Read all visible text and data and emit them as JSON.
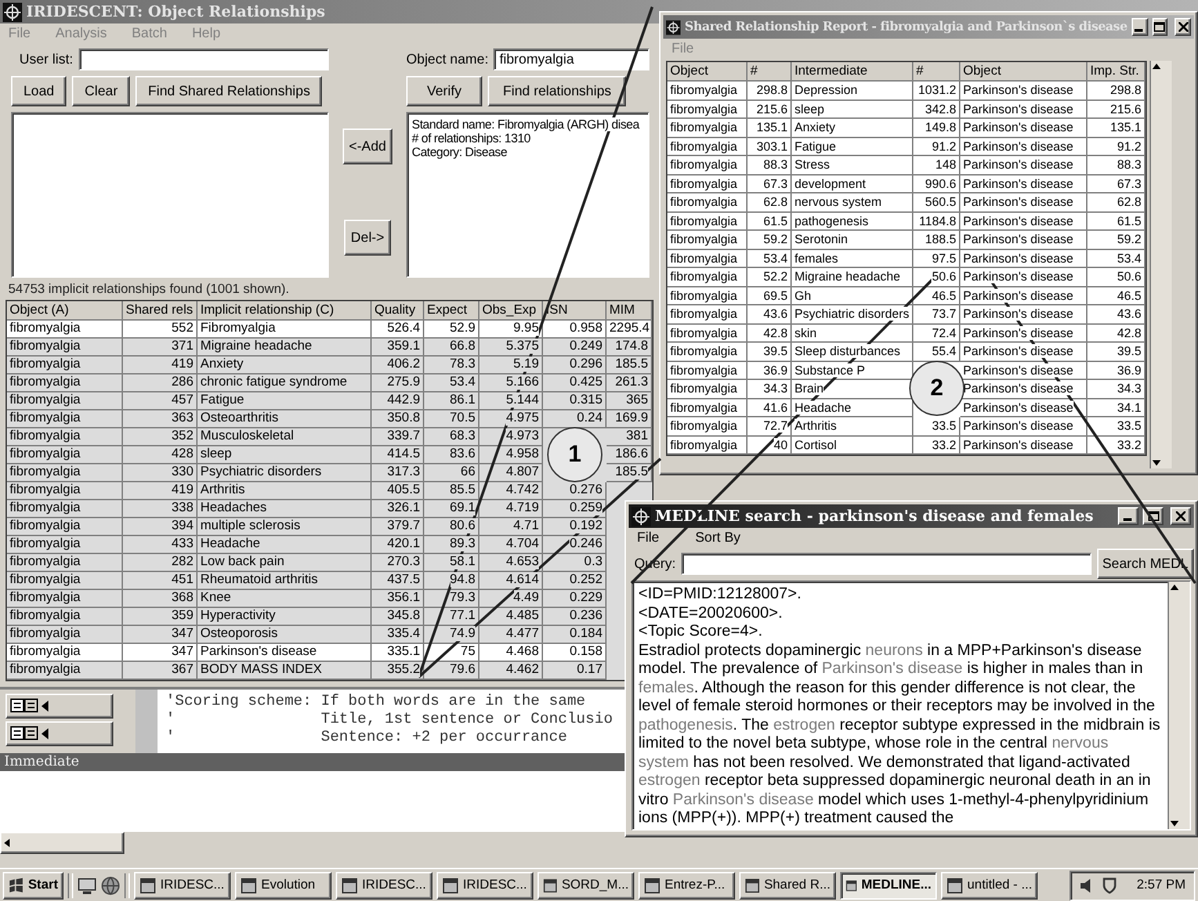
{
  "main_window": {
    "title": "IRIDESCENT: Object Relationships",
    "menu": [
      "File",
      "Analysis",
      "Batch",
      "Help"
    ],
    "user_list": {
      "label": "User list:"
    },
    "left_buttons": [
      "Load",
      "Clear",
      "Find Shared Relationships"
    ],
    "middle_buttons": [
      "<-Add",
      "Del->"
    ],
    "object_name": {
      "label": "Object name:",
      "value": "fibromyalgia"
    },
    "right_buttons": [
      "Verify",
      "Find relationships"
    ],
    "info_lines": [
      "Standard name: Fibromyalgia (ARGH) disea",
      "# of relationships: 1310",
      "Category: Disease"
    ],
    "status": "54753 implicit relationships found (1001 shown).",
    "table": {
      "columns": [
        "Object (A)",
        "Shared rels",
        "Implicit relationship (C)",
        "Quality",
        "Expect",
        "Obs_Exp",
        "ISN",
        "MIM"
      ],
      "rows": [
        {
          "object": "fibromyalgia",
          "shared": "552",
          "relationship": "Fibromyalgia",
          "quality": "526.4",
          "expect": "52.9",
          "obs_exp": "9.95",
          "isn": "0.958",
          "mim": "2295.4",
          "selected": true
        },
        {
          "object": "fibromyalgia",
          "shared": "371",
          "relationship": "Migraine headache",
          "quality": "359.1",
          "expect": "66.8",
          "obs_exp": "5.375",
          "isn": "0.249",
          "mim": "174.8",
          "selected": false
        },
        {
          "object": "fibromyalgia",
          "shared": "419",
          "relationship": "Anxiety",
          "quality": "406.2",
          "expect": "78.3",
          "obs_exp": "5.19",
          "isn": "0.296",
          "mim": "185.5",
          "selected": false
        },
        {
          "object": "fibromyalgia",
          "shared": "286",
          "relationship": "chronic fatigue syndrome",
          "quality": "275.9",
          "expect": "53.4",
          "obs_exp": "5.166",
          "isn": "0.425",
          "mim": "261.3",
          "selected": false
        },
        {
          "object": "fibromyalgia",
          "shared": "457",
          "relationship": "Fatigue",
          "quality": "442.9",
          "expect": "86.1",
          "obs_exp": "5.144",
          "isn": "0.315",
          "mim": "365",
          "selected": false
        },
        {
          "object": "fibromyalgia",
          "shared": "363",
          "relationship": "Osteoarthritis",
          "quality": "350.8",
          "expect": "70.5",
          "obs_exp": "4.975",
          "isn": "0.24",
          "mim": "169.9",
          "selected": false
        },
        {
          "object": "fibromyalgia",
          "shared": "352",
          "relationship": "Musculoskeletal",
          "quality": "339.7",
          "expect": "68.3",
          "obs_exp": "4.973",
          "mim": "381",
          "selected": false
        },
        {
          "object": "fibromyalgia",
          "shared": "428",
          "relationship": "sleep",
          "quality": "414.5",
          "expect": "83.6",
          "obs_exp": "4.958",
          "mim": "186.6",
          "selected": false
        },
        {
          "object": "fibromyalgia",
          "shared": "330",
          "relationship": "Psychiatric disorders",
          "quality": "317.3",
          "expect": "66",
          "obs_exp": "4.807",
          "mim": "185.5",
          "selected": false
        },
        {
          "object": "fibromyalgia",
          "shared": "419",
          "relationship": "Arthritis",
          "quality": "405.5",
          "expect": "85.5",
          "obs_exp": "4.742",
          "isn": "0.276",
          "selected": false
        },
        {
          "object": "fibromyalgia",
          "shared": "338",
          "relationship": "Headaches",
          "quality": "326.1",
          "expect": "69.1",
          "obs_exp": "4.719",
          "isn": "0.259",
          "selected": false
        },
        {
          "object": "fibromyalgia",
          "shared": "394",
          "relationship": "multiple sclerosis",
          "quality": "379.7",
          "expect": "80.6",
          "obs_exp": "4.71",
          "isn": "0.192",
          "selected": false
        },
        {
          "object": "fibromyalgia",
          "shared": "433",
          "relationship": "Headache",
          "quality": "420.1",
          "expect": "89.3",
          "obs_exp": "4.704",
          "isn": "0.246",
          "selected": false
        },
        {
          "object": "fibromyalgia",
          "shared": "282",
          "relationship": "Low back pain",
          "quality": "270.3",
          "expect": "58.1",
          "obs_exp": "4.653",
          "isn": "0.3",
          "selected": false
        },
        {
          "object": "fibromyalgia",
          "shared": "451",
          "relationship": "Rheumatoid arthritis",
          "quality": "437.5",
          "expect": "94.8",
          "obs_exp": "4.614",
          "isn": "0.252",
          "selected": false
        },
        {
          "object": "fibromyalgia",
          "shared": "368",
          "relationship": "Knee",
          "quality": "356.1",
          "expect": "79.3",
          "obs_exp": "4.49",
          "isn": "0.229",
          "selected": false
        },
        {
          "object": "fibromyalgia",
          "shared": "359",
          "relationship": "Hyperactivity",
          "quality": "345.8",
          "expect": "77.1",
          "obs_exp": "4.485",
          "isn": "0.236",
          "selected": false
        },
        {
          "object": "fibromyalgia",
          "shared": "347",
          "relationship": "Osteoporosis",
          "quality": "335.4",
          "expect": "74.9",
          "obs_exp": "4.477",
          "isn": "0.184",
          "selected": false
        },
        {
          "object": "fibromyalgia",
          "shared": "347",
          "relationship": "Parkinson's disease",
          "quality": "335.1",
          "expect": "75",
          "obs_exp": "4.468",
          "isn": "0.158",
          "selected": true
        },
        {
          "object": "fibromyalgia",
          "shared": "367",
          "relationship": "BODY MASS INDEX",
          "quality": "355.2",
          "expect": "79.6",
          "obs_exp": "4.462",
          "isn": "0.17",
          "selected": false
        }
      ]
    },
    "code_lines": [
      "'Scoring scheme: If both words are in the same",
      "'                Title, 1st sentence or Conclusio",
      "'                Sentence: +2 per occurrance"
    ],
    "immediate": {
      "title": "Immediate"
    }
  },
  "report_window": {
    "title": "Shared Relationship Report - fibromyalgia and Parkinson`s disease",
    "menu": [
      "File"
    ],
    "columns": [
      "Object",
      "#",
      "Intermediate",
      "#",
      "Object",
      "Imp. Str."
    ],
    "rows": [
      {
        "a": "fibromyalgia",
        "n1": "298.8",
        "mid": "Depression",
        "n2": "1031.2",
        "b": "Parkinson's disease",
        "imp": "298.8"
      },
      {
        "a": "fibromyalgia",
        "n1": "215.6",
        "mid": "sleep",
        "n2": "342.8",
        "b": "Parkinson's disease",
        "imp": "215.6"
      },
      {
        "a": "fibromyalgia",
        "n1": "135.1",
        "mid": "Anxiety",
        "n2": "149.8",
        "b": "Parkinson's disease",
        "imp": "135.1"
      },
      {
        "a": "fibromyalgia",
        "n1": "303.1",
        "mid": "Fatigue",
        "n2": "91.2",
        "b": "Parkinson's disease",
        "imp": "91.2"
      },
      {
        "a": "fibromyalgia",
        "n1": "88.3",
        "mid": "Stress",
        "n2": "148",
        "b": "Parkinson's disease",
        "imp": "88.3"
      },
      {
        "a": "fibromyalgia",
        "n1": "67.3",
        "mid": "development",
        "n2": "990.6",
        "b": "Parkinson's disease",
        "imp": "67.3"
      },
      {
        "a": "fibromyalgia",
        "n1": "62.8",
        "mid": "nervous system",
        "n2": "560.5",
        "b": "Parkinson's disease",
        "imp": "62.8"
      },
      {
        "a": "fibromyalgia",
        "n1": "61.5",
        "mid": "pathogenesis",
        "n2": "1184.8",
        "b": "Parkinson's disease",
        "imp": "61.5"
      },
      {
        "a": "fibromyalgia",
        "n1": "59.2",
        "mid": "Serotonin",
        "n2": "188.5",
        "b": "Parkinson's disease",
        "imp": "59.2"
      },
      {
        "a": "fibromyalgia",
        "n1": "53.4",
        "mid": "females",
        "n2": "97.5",
        "b": "Parkinson's disease",
        "imp": "53.4"
      },
      {
        "a": "fibromyalgia",
        "n1": "52.2",
        "mid": "Migraine headache",
        "n2": "50.6",
        "b": "Parkinson's disease",
        "imp": "50.6"
      },
      {
        "a": "fibromyalgia",
        "n1": "69.5",
        "mid": "Gh",
        "n2": "46.5",
        "b": "Parkinson's disease",
        "imp": "46.5"
      },
      {
        "a": "fibromyalgia",
        "n1": "43.6",
        "mid": "Psychiatric disorders",
        "n2": "73.7",
        "b": "Parkinson's disease",
        "imp": "43.6"
      },
      {
        "a": "fibromyalgia",
        "n1": "42.8",
        "mid": "skin",
        "n2": "72.4",
        "b": "Parkinson's disease",
        "imp": "42.8"
      },
      {
        "a": "fibromyalgia",
        "n1": "39.5",
        "mid": "Sleep disturbances",
        "n2": "55.4",
        "b": "Parkinson's disease",
        "imp": "39.5"
      },
      {
        "a": "fibromyalgia",
        "n1": "36.9",
        "mid": "Substance P",
        "b": "Parkinson's disease",
        "imp": "36.9"
      },
      {
        "a": "fibromyalgia",
        "n1": "34.3",
        "mid": "Brain",
        "b": "Parkinson's disease",
        "imp": "34.3"
      },
      {
        "a": "fibromyalgia",
        "n1": "41.6",
        "mid": "Headache",
        "b": "Parkinson's disease",
        "imp": "34.1"
      },
      {
        "a": "fibromyalgia",
        "n1": "72.7",
        "mid": "Arthritis",
        "n2": "33.5",
        "b": "Parkinson's disease",
        "imp": "33.5"
      },
      {
        "a": "fibromyalgia",
        "n1": "40",
        "mid": "Cortisol",
        "n2": "33.2",
        "b": "Parkinson's disease",
        "imp": "33.2"
      }
    ]
  },
  "medline_window": {
    "title": "MEDLINE search - parkinson's disease and females",
    "menu": [
      "File",
      "Sort By"
    ],
    "query": {
      "label": "Query:"
    },
    "search_button": "Search MEDL",
    "header_lines": [
      "<ID=PMID:12128007>.",
      "<DATE=20020600>.",
      "<Topic Score=4>."
    ],
    "abstract": [
      {
        "text": "Estradiol protects dopaminergic ",
        "highlight": false
      },
      {
        "text": "neurons",
        "highlight": true
      },
      {
        "text": " in a MPP+Parkinson's disease model. The prevalence of ",
        "highlight": false
      },
      {
        "text": "Parkinson's disease",
        "highlight": true
      },
      {
        "text": " is higher in males than in ",
        "highlight": false
      },
      {
        "text": "females",
        "highlight": true
      },
      {
        "text": ". Although the reason for this gender difference is not clear, the level of female steroid hormones or their receptors may be involved in the ",
        "highlight": false
      },
      {
        "text": "pathogenesis",
        "highlight": true
      },
      {
        "text": ". The ",
        "highlight": false
      },
      {
        "text": "estrogen",
        "highlight": true
      },
      {
        "text": " receptor subtype expressed in the midbrain is limited to the novel beta subtype, whose role in the central ",
        "highlight": false
      },
      {
        "text": "nervous system",
        "highlight": true
      },
      {
        "text": " has not been resolved. We demonstrated that ligand-activated ",
        "highlight": false
      },
      {
        "text": "estrogen",
        "highlight": true
      },
      {
        "text": " receptor beta suppressed dopaminergic neuronal death in an in vitro ",
        "highlight": false
      },
      {
        "text": "Parkinson's disease",
        "highlight": true
      },
      {
        "text": " model which uses 1-methyl-4-phenylpyridinium ions (MPP(+)). MPP(+) treatment caused the",
        "highlight": false
      }
    ]
  },
  "callouts": [
    {
      "label": "1"
    },
    {
      "label": "2"
    }
  ],
  "taskbar": {
    "start": "Start",
    "tasks": [
      {
        "label": "IRIDESC...",
        "selected": false
      },
      {
        "label": "Evolution",
        "selected": false
      },
      {
        "label": "IRIDESC...",
        "selected": false
      },
      {
        "label": "IRIDESC...",
        "selected": false
      },
      {
        "label": "SORD_M...",
        "selected": false
      },
      {
        "label": "Entrez-P...",
        "selected": false
      },
      {
        "label": "Shared R...",
        "selected": false
      },
      {
        "label": "MEDLINE...",
        "selected": true
      },
      {
        "label": "untitled - ...",
        "selected": false
      }
    ],
    "clock": "2:57 PM"
  }
}
